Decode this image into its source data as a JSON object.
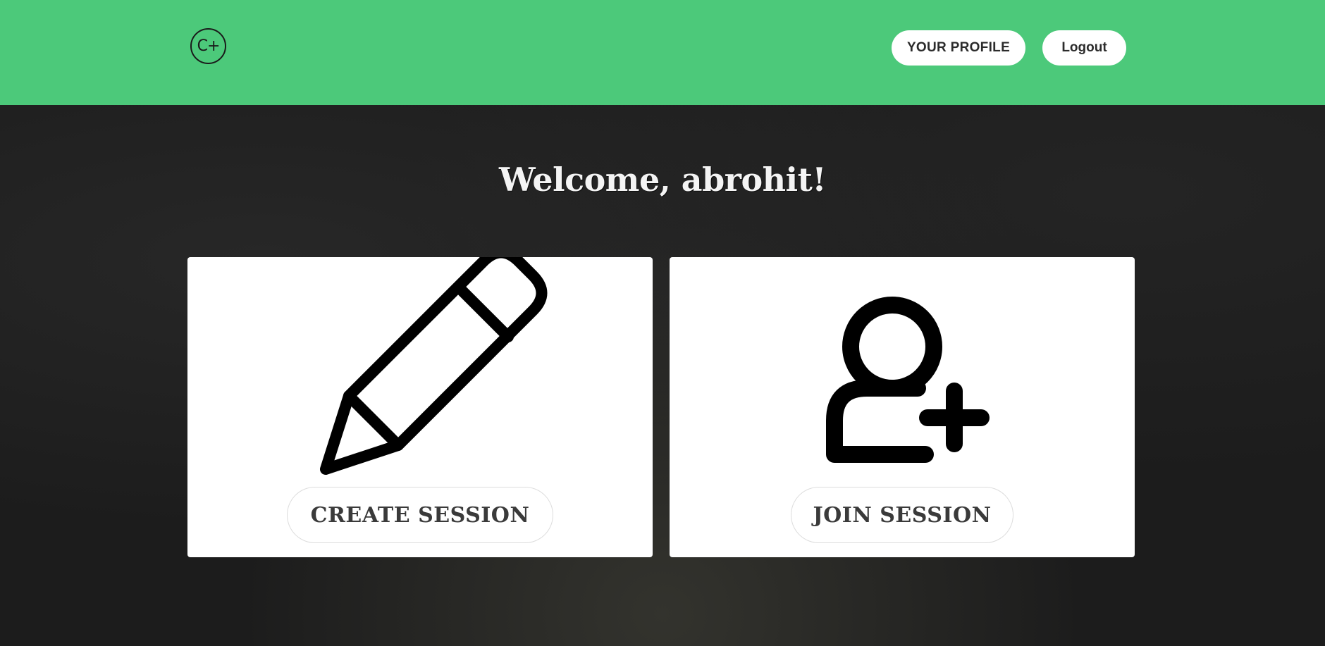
{
  "header": {
    "logo_text": "C+",
    "profile_label": "YOUR PROFILE",
    "logout_label": "Logout"
  },
  "main": {
    "welcome": "Welcome, abrohit!",
    "cards": [
      {
        "icon": "pencil-icon",
        "button_label": "CREATE SESSION"
      },
      {
        "icon": "add-user-icon",
        "button_label": "JOIN SESSION"
      }
    ]
  },
  "colors": {
    "navbar": "#4cc97a",
    "background": "#1c1c1c",
    "card": "#ffffff"
  }
}
